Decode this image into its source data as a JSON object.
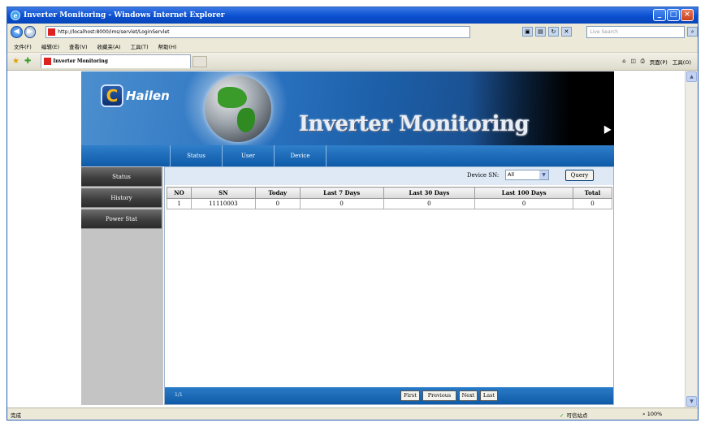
{
  "window": {
    "title": "Inverter Monitoring - Windows Internet Explorer",
    "controls": {
      "minimize": "_",
      "maximize": "□",
      "close": "×"
    }
  },
  "address_bar": {
    "url": "http://localhost:8000/ims/servlet/LoginServlet",
    "search_placeholder": "Live Search",
    "back_glyph": "◀",
    "forward_glyph": "▶"
  },
  "menu": {
    "items": [
      "文件(F)",
      "编辑(E)",
      "查看(V)",
      "收藏夹(A)",
      "工具(T)",
      "帮助(H)"
    ]
  },
  "tab": {
    "title": "Inverter Monitoring"
  },
  "command_bar": {
    "items": [
      "页面(P)",
      "工具(O)"
    ]
  },
  "banner": {
    "brand": "Hailen",
    "title": "Inverter Monitoring"
  },
  "topnav": {
    "items": [
      "Status",
      "User",
      "Device"
    ]
  },
  "sidebar": {
    "items": [
      "Status",
      "History",
      "Power Stat"
    ]
  },
  "filter": {
    "label": "Device SN:",
    "selected": "All",
    "query_label": "Query"
  },
  "table": {
    "headers": [
      "NO",
      "SN",
      "Today",
      "Last 7 Days",
      "Last 30 Days",
      "Last 100 Days",
      "Total"
    ],
    "rows": [
      [
        "1",
        "11110003",
        "0",
        "0",
        "0",
        "0",
        "0"
      ]
    ]
  },
  "pager": {
    "info": "1/1",
    "first": "First",
    "previous": "Previous",
    "next": "Next",
    "last": "Last"
  },
  "statusbar": {
    "left": "完成",
    "zone": "可信站点",
    "zoom": "100%"
  }
}
